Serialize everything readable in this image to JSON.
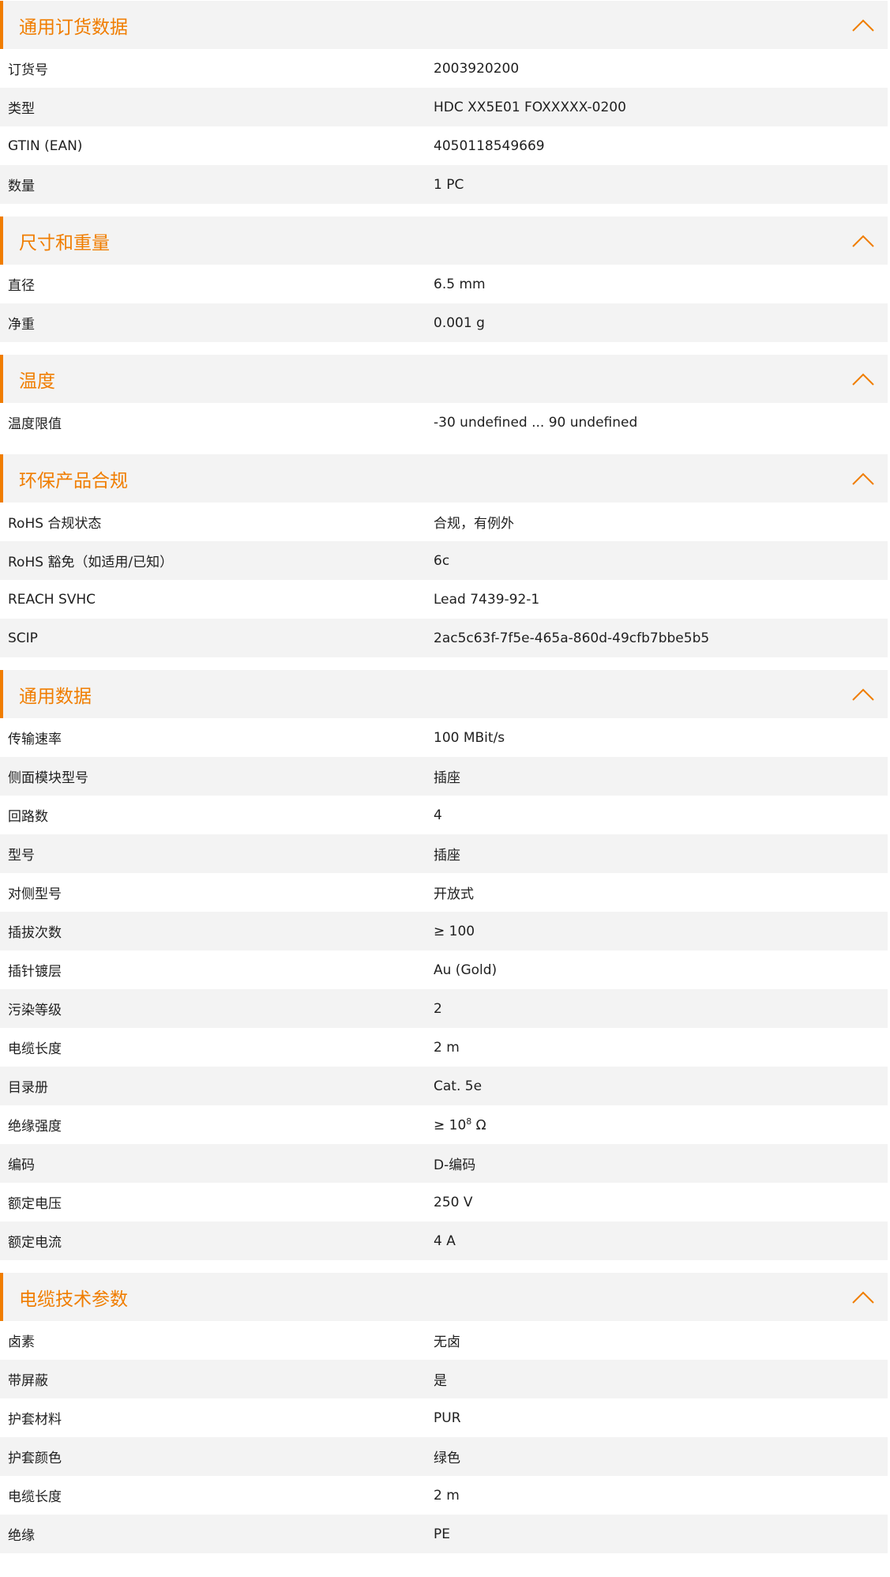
{
  "accent": "#f07d00",
  "sections": [
    {
      "title": "通用订货数据",
      "rows": [
        {
          "label": "订货号",
          "value": "2003920200"
        },
        {
          "label": "类型",
          "value": "HDC XX5E01 FOXXXXX-0200"
        },
        {
          "label": "GTIN (EAN)",
          "value": "4050118549669"
        },
        {
          "label": "数量",
          "value": "1  PC"
        }
      ]
    },
    {
      "title": "尺寸和重量",
      "rows": [
        {
          "label": "直径",
          "value": "6.5  mm"
        },
        {
          "label": "净重",
          "value": "0.001  g"
        }
      ]
    },
    {
      "title": "温度",
      "rows": [
        {
          "label": "温度限值",
          "value": "-30 undefined ... 90 undefined"
        }
      ]
    },
    {
      "title": "环保产品合规",
      "rows": [
        {
          "label": "RoHS 合规状态",
          "value": "合规，有例外"
        },
        {
          "label": "RoHS 豁免（如适用/已知）",
          "value": "6c"
        },
        {
          "label": "REACH SVHC",
          "value": "Lead 7439-92-1"
        },
        {
          "label": "SCIP",
          "value": "2ac5c63f-7f5e-465a-860d-49cfb7bbe5b5"
        }
      ]
    },
    {
      "title": "通用数据",
      "rows": [
        {
          "label": "传输速率",
          "value": "100 MBit/s"
        },
        {
          "label": "侧面模块型号",
          "value": "插座"
        },
        {
          "label": "回路数",
          "value": "4"
        },
        {
          "label": "型号",
          "value": "插座"
        },
        {
          "label": "对侧型号",
          "value": "开放式"
        },
        {
          "label": "插拔次数",
          "value": "≥ 100"
        },
        {
          "label": "插针镀层",
          "value": "Au (Gold)"
        },
        {
          "label": "污染等级",
          "value": "2"
        },
        {
          "label": "电缆长度",
          "value": "2  m"
        },
        {
          "label": "目录册",
          "value": "Cat. 5e"
        },
        {
          "label": "绝缘强度",
          "value": "≥ 10",
          "sup": "8",
          "unit": " Ω"
        },
        {
          "label": "编码",
          "value": "D-编码"
        },
        {
          "label": "额定电压",
          "value": "250  V"
        },
        {
          "label": "额定电流",
          "value": "4  A"
        }
      ]
    },
    {
      "title": "电缆技术参数",
      "rows": [
        {
          "label": "卤素",
          "value": "无卤"
        },
        {
          "label": "带屏蔽",
          "value": "是"
        },
        {
          "label": "护套材料",
          "value": "PUR"
        },
        {
          "label": "护套颜色",
          "value": "绿色"
        },
        {
          "label": "电缆长度",
          "value": "2  m"
        },
        {
          "label": "绝缘",
          "value": "PE"
        }
      ]
    }
  ]
}
